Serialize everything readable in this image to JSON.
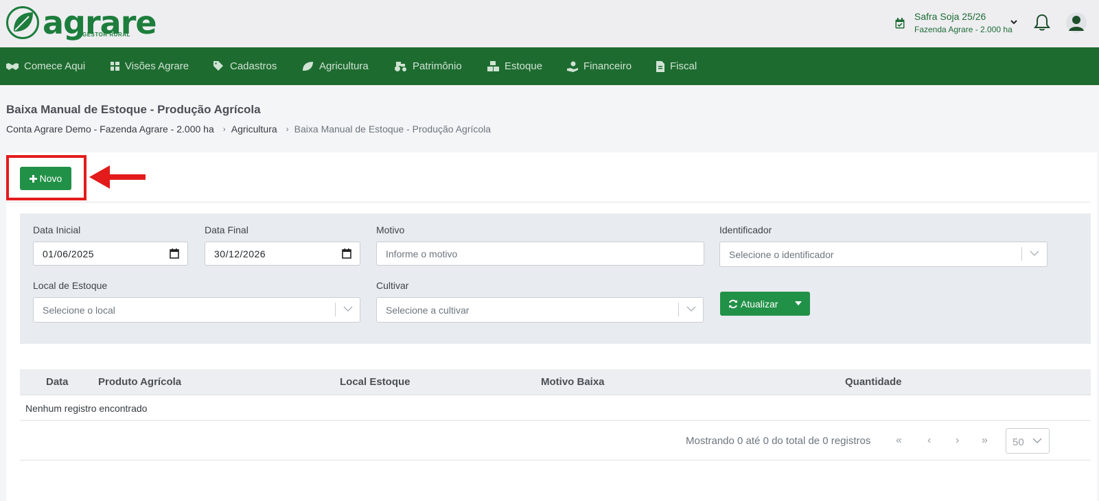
{
  "brand": {
    "name": "agrare",
    "tagline": "GESTOR RURAL",
    "color": "#1d7d3c"
  },
  "header": {
    "safra_title": "Safra Soja 25/26",
    "safra_farm": "Fazenda Agrare - 2.000 ha"
  },
  "nav": {
    "items": [
      {
        "label": "Comece Aqui",
        "icon": "handshake-icon"
      },
      {
        "label": "Visões Agrare",
        "icon": "dashboard-icon"
      },
      {
        "label": "Cadastros",
        "icon": "tags-icon"
      },
      {
        "label": "Agricultura",
        "icon": "leaf-icon"
      },
      {
        "label": "Patrimônio",
        "icon": "tractor-icon"
      },
      {
        "label": "Estoque",
        "icon": "boxes-icon"
      },
      {
        "label": "Financeiro",
        "icon": "hand-coin-icon"
      },
      {
        "label": "Fiscal",
        "icon": "invoice-icon"
      }
    ],
    "color": "#1e6b30"
  },
  "page": {
    "title": "Baixa Manual de Estoque - Produção Agrícola",
    "breadcrumb": [
      "Conta Agrare Demo - Fazenda Agrare - 2.000 ha",
      "Agricultura",
      "Baixa Manual de Estoque - Produção Agrícola"
    ]
  },
  "actions": {
    "new_label": "Novo"
  },
  "filters": {
    "data_inicial_label": "Data Inicial",
    "data_inicial_value": "01/06/2025",
    "data_final_label": "Data Final",
    "data_final_value": "30/12/2026",
    "motivo_label": "Motivo",
    "motivo_placeholder": "Informe o motivo",
    "identificador_label": "Identificador",
    "identificador_placeholder": "Selecione o identificador",
    "local_label": "Local de Estoque",
    "local_placeholder": "Selecione o local",
    "cultivar_label": "Cultivar",
    "cultivar_placeholder": "Selecione a cultivar",
    "refresh_label": "Atualizar"
  },
  "table": {
    "columns": [
      "Data",
      "Produto Agrícola",
      "Local Estoque",
      "Motivo Baixa",
      "Quantidade"
    ],
    "empty_message": "Nenhum registro encontrado"
  },
  "pagination": {
    "info": "Mostrando 0 até 0 do total de 0 registros",
    "first": "«",
    "prev": "‹",
    "next": "›",
    "last": "»",
    "page_size": "50"
  },
  "colors": {
    "accent": "#229148",
    "highlight": "#e31b1b"
  }
}
